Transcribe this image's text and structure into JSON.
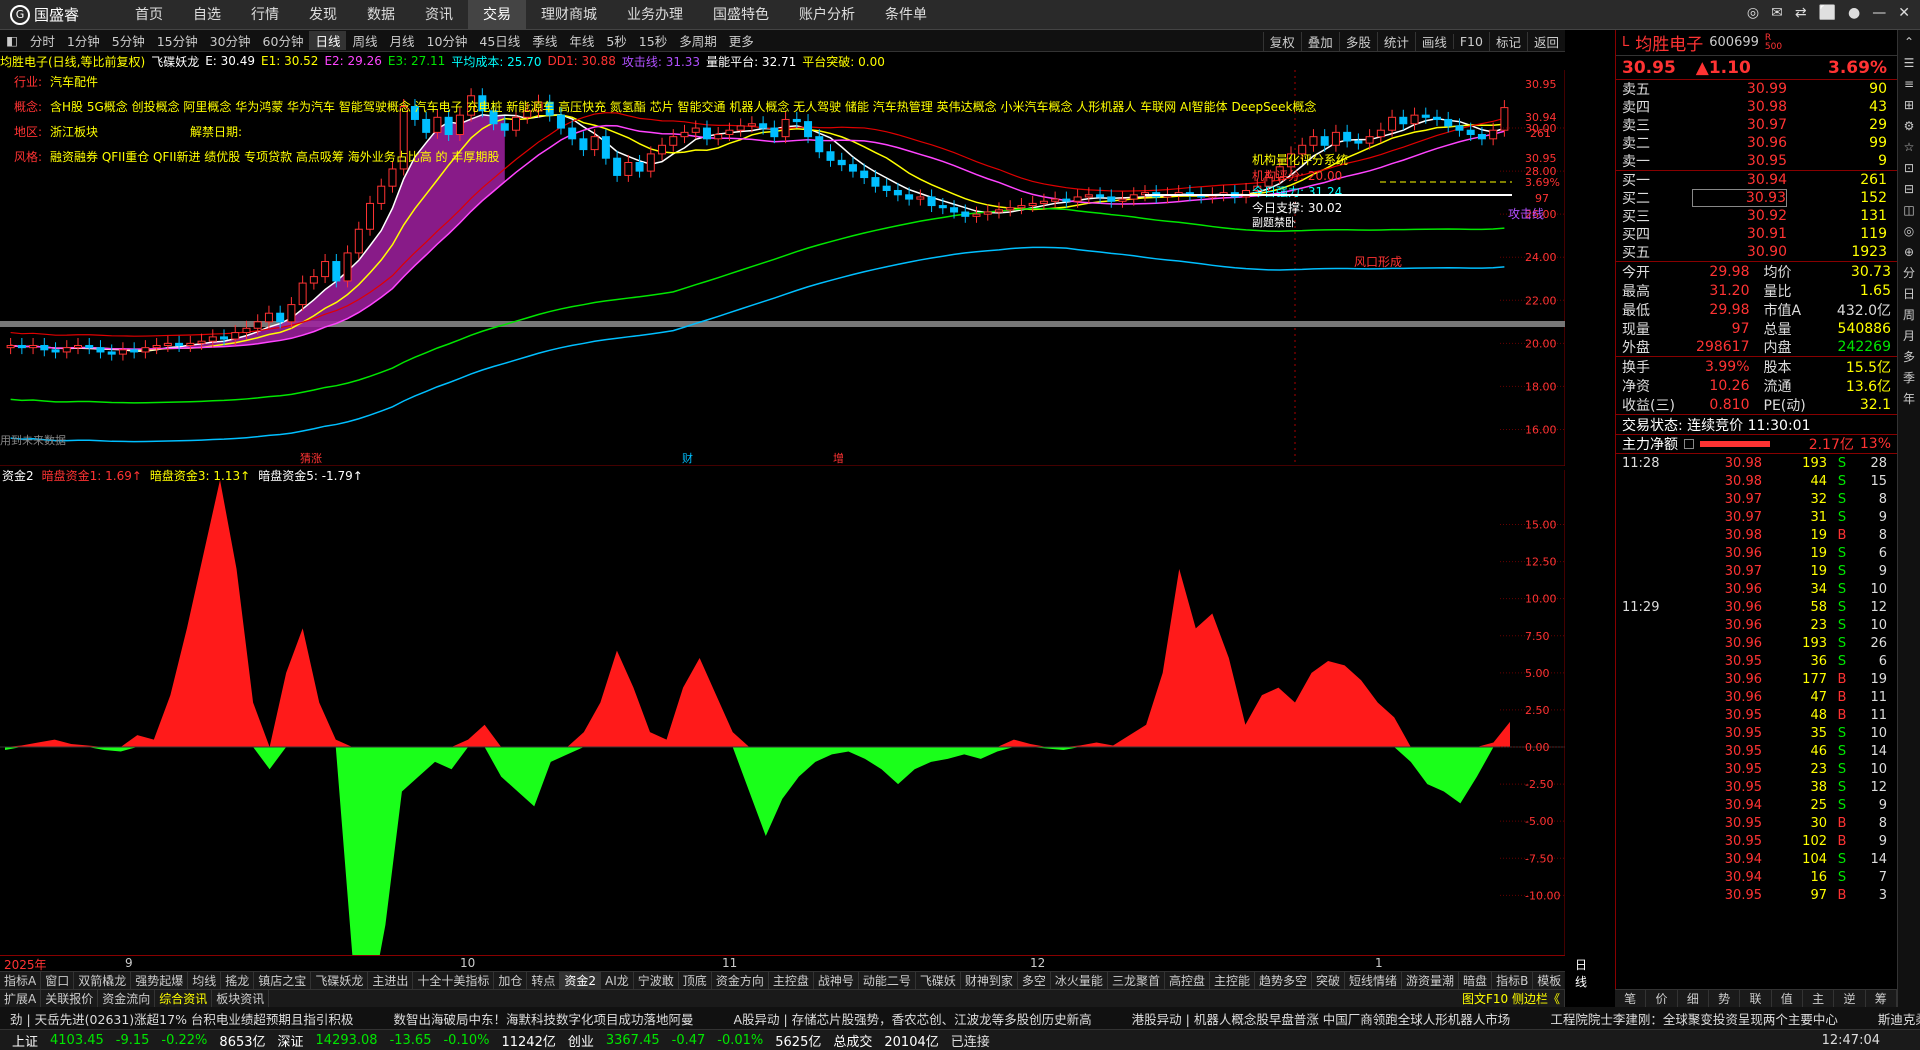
{
  "app": {
    "logo": "国盛睿"
  },
  "menu": [
    "首页",
    "自选",
    "行情",
    "发现",
    "数据",
    "资讯",
    "交易",
    "理财商城",
    "业务办理",
    "国盛特色",
    "账户分析",
    "条件单"
  ],
  "window_controls": [
    "◎",
    "✉",
    "⇄",
    "⬜",
    "●",
    "—",
    "✕"
  ],
  "periods": [
    "分时",
    "1分钟",
    "5分钟",
    "15分钟",
    "30分钟",
    "60分钟",
    "日线",
    "周线",
    "月线",
    "10分钟",
    "45日线",
    "季线",
    "年线",
    "5秒",
    "15秒",
    "多周期",
    "更多"
  ],
  "period_selected": "日线",
  "chart_tools": [
    "复权",
    "叠加",
    "多股",
    "统计",
    "画线",
    "F10",
    "标记",
    "返回"
  ],
  "kline_info": {
    "title": "均胜电子(日线,等比前复权)",
    "indicator": "飞碟妖龙",
    "e": "E: 30.49",
    "e1": "E1: 30.52",
    "e2": "E2: 29.26",
    "e3": "E3: 27.11",
    "avg_cost": "平均成本: 25.70",
    "dd1": "DD1: 30.88",
    "attack": "攻击线: 31.33",
    "platform": "量能平台: 32.71",
    "breakout": "平台突破: 0.00"
  },
  "overlay": {
    "industry_label": "行业:",
    "industry": "汽车配件",
    "concept_label": "概念:",
    "concepts": "含H股 5G概念 创投概念 阿里概念 华为鸿蒙 华为汽车 智能驾驶概念 汽车电子 充电桩 新能源车 高压快充 氮氢酯 芯片 智能交通 机器人概念 无人驾驶 储能 汽车热管理 英伟达概念 小米汽车概念 人形机器人 车联网 AI智能体 DeepSeek概念",
    "region_label": "地区:",
    "region": "浙江板块",
    "unlock_label": "解禁日期:",
    "style_label": "风格:",
    "styles": "融资融券 QFII重仓 QFII新进 绩优股 专项贷款 高点吸筹 海外业务占比高 的 丰厚期股",
    "note": "用到未来数据",
    "score_title": "机构量化评分系统",
    "score": "机构评分: 20.00",
    "force": "今日强力: 31.24",
    "support": "今日支撑: 30.02",
    "sideline": "副题禁卧",
    "attack_tag": "攻击线",
    "fengkou": "风口形成",
    "marks": [
      "猜涨",
      "财",
      "增"
    ]
  },
  "price_axis": [
    "30.95",
    "30.94",
    "261",
    "30.95",
    "3.69%",
    "97",
    "30.00",
    "28.00",
    "26.00",
    "24.00",
    "22.00",
    "20.00",
    "18.00",
    "16.00"
  ],
  "sub_info": {
    "name": "资金2",
    "f1": "暗盘资金1: 1.69↑",
    "f3": "暗盘资金3: 1.13↑",
    "f5": "暗盘资金5: -1.79↑"
  },
  "sub_axis": [
    "15.00",
    "12.50",
    "10.00",
    "7.50",
    "5.00",
    "2.50",
    "0.00",
    "-2.50",
    "-5.00",
    "-7.50",
    "-10.00"
  ],
  "x_axis": [
    "2025年",
    "9",
    "10",
    "11",
    "12",
    "1"
  ],
  "x_axis_right": "日线",
  "tabs1": [
    "指标A",
    "窗口",
    "双箭橇龙",
    "强势起爆",
    "均线",
    "搖龙",
    "镇店之宝",
    "飞碟妖龙",
    "主进出",
    "十全十美指标",
    "加仓",
    "转点",
    "资金2",
    "AI龙",
    "宁波敢",
    "顶底",
    "资金方向",
    "主控盘",
    "战神号",
    "动能二号",
    "飞碟妖",
    "财神到家",
    "多空",
    "冰火量能",
    "三龙聚首",
    "高控盘",
    "主控能",
    "趋势多空",
    "突破",
    "短线情绪",
    "游资量潮",
    "暗盘",
    "指标B",
    "模板"
  ],
  "tabs1_selected": "资金2",
  "tabs2": [
    "扩展A",
    "关联报价",
    "资金流向",
    "综合资讯",
    "板块资讯"
  ],
  "tabs2_selected": "综合资讯",
  "tabs2_right": "图文F10 侧边栏《",
  "ticker": [
    "劲 | 天岳先进(02631)涨超17% 台积电业绩超预期且指引积极",
    "数智出海破局中东！海默科技数字化项目成功落地阿曼",
    "A股异动 | 存储芯片股强势，香农芯创、江波龙等多股创历史新高",
    "港股异动 | 机器人概念股早盘普涨 中国厂商领跑全球人形机器人市场",
    "工程院院士李建刚：全球聚变投资呈现两个主要中心",
    "斯迪克柔性三维"
  ],
  "status": {
    "sh_label": "上证",
    "sh_val": "4103.45",
    "sh_chg": "-9.15",
    "sh_pct": "-0.22%",
    "sh_amt": "8653亿",
    "sz_label": "深证",
    "sz_val": "14293.08",
    "sz_chg": "-13.65",
    "sz_pct": "-0.10%",
    "sz_amt": "11242亿",
    "cy_label": "创业",
    "cy_val": "3367.45",
    "cy_chg": "-0.47",
    "cy_pct": "-0.01%",
    "cy_amt": "5625亿",
    "total_label": "总成交",
    "total": "20104亿",
    "conn": "已连接",
    "time": "12:47:04"
  },
  "right": {
    "prefix": "L",
    "name": "均胜电子",
    "code": "600699",
    "code_tag": "R 500",
    "price": "30.95",
    "change": "▲1.10",
    "pct": "3.69%",
    "asks": [
      {
        "l": "卖五",
        "p": "30.99",
        "v": "90"
      },
      {
        "l": "卖四",
        "p": "30.98",
        "v": "43"
      },
      {
        "l": "卖三",
        "p": "30.97",
        "v": "29"
      },
      {
        "l": "卖二",
        "p": "30.96",
        "v": "99"
      },
      {
        "l": "卖一",
        "p": "30.95",
        "v": "9"
      }
    ],
    "bids": [
      {
        "l": "买一",
        "p": "30.94",
        "v": "261"
      },
      {
        "l": "买二",
        "p": "30.93",
        "v": "152"
      },
      {
        "l": "买三",
        "p": "30.92",
        "v": "131"
      },
      {
        "l": "买四",
        "p": "30.91",
        "v": "119"
      },
      {
        "l": "买五",
        "p": "30.90",
        "v": "1923"
      }
    ],
    "stats": [
      [
        "今开",
        "29.98",
        "均价",
        "30.73"
      ],
      [
        "最高",
        "31.20",
        "量比",
        "1.65"
      ],
      [
        "最低",
        "29.98",
        "市值A",
        "432.0亿"
      ],
      [
        "现量",
        "97",
        "总量",
        "540886"
      ],
      [
        "外盘",
        "298617",
        "内盘",
        "242269"
      ],
      [
        "换手",
        "3.99%",
        "股本",
        "15.5亿"
      ],
      [
        "净资",
        "10.26",
        "流通",
        "13.6亿"
      ],
      [
        "收益(三)",
        "0.810",
        "PE(动)",
        "32.1"
      ]
    ],
    "trade_state": "交易状态: 连续竞价 11:30:01",
    "net_label": "主力净额",
    "net_val": "2.17亿",
    "net_pct": "13%",
    "ticks": [
      {
        "t": "11:28",
        "p": "30.98",
        "v": "193",
        "s": "S",
        "n": "28"
      },
      {
        "t": "",
        "p": "30.98",
        "v": "44",
        "s": "S",
        "n": "15"
      },
      {
        "t": "",
        "p": "30.97",
        "v": "32",
        "s": "S",
        "n": "8"
      },
      {
        "t": "",
        "p": "30.97",
        "v": "31",
        "s": "S",
        "n": "9"
      },
      {
        "t": "",
        "p": "30.98",
        "v": "19",
        "s": "B",
        "n": "8"
      },
      {
        "t": "",
        "p": "30.96",
        "v": "19",
        "s": "S",
        "n": "6"
      },
      {
        "t": "",
        "p": "30.97",
        "v": "19",
        "s": "S",
        "n": "9"
      },
      {
        "t": "",
        "p": "30.96",
        "v": "34",
        "s": "S",
        "n": "10"
      },
      {
        "t": "11:29",
        "p": "30.96",
        "v": "58",
        "s": "S",
        "n": "12"
      },
      {
        "t": "",
        "p": "30.96",
        "v": "23",
        "s": "S",
        "n": "10"
      },
      {
        "t": "",
        "p": "30.96",
        "v": "193",
        "s": "S",
        "n": "26"
      },
      {
        "t": "",
        "p": "30.95",
        "v": "36",
        "s": "S",
        "n": "6"
      },
      {
        "t": "",
        "p": "30.96",
        "v": "177",
        "s": "B",
        "n": "19"
      },
      {
        "t": "",
        "p": "30.96",
        "v": "47",
        "s": "B",
        "n": "11"
      },
      {
        "t": "",
        "p": "30.95",
        "v": "48",
        "s": "B",
        "n": "11"
      },
      {
        "t": "",
        "p": "30.95",
        "v": "35",
        "s": "S",
        "n": "10"
      },
      {
        "t": "",
        "p": "30.95",
        "v": "46",
        "s": "S",
        "n": "14"
      },
      {
        "t": "",
        "p": "30.95",
        "v": "23",
        "s": "S",
        "n": "10"
      },
      {
        "t": "",
        "p": "30.95",
        "v": "38",
        "s": "S",
        "n": "12"
      },
      {
        "t": "",
        "p": "30.94",
        "v": "25",
        "s": "S",
        "n": "9"
      },
      {
        "t": "",
        "p": "30.95",
        "v": "30",
        "s": "B",
        "n": "8"
      },
      {
        "t": "",
        "p": "30.95",
        "v": "102",
        "s": "B",
        "n": "9"
      },
      {
        "t": "",
        "p": "30.94",
        "v": "104",
        "s": "S",
        "n": "14"
      },
      {
        "t": "",
        "p": "30.94",
        "v": "16",
        "s": "S",
        "n": "7"
      },
      {
        "t": "",
        "p": "30.95",
        "v": "97",
        "s": "B",
        "n": "3"
      }
    ],
    "bottom_tabs": [
      "笔",
      "价",
      "细",
      "势",
      "联",
      "值",
      "主",
      "逆",
      "筹"
    ]
  },
  "vtabs": [
    "⌃",
    "☰",
    "≡",
    "⊞",
    "⚙",
    "☆",
    "⊡",
    "⊟",
    "◫",
    "◎",
    "⊕",
    "分",
    "日",
    "周",
    "月",
    "多",
    "季",
    "年"
  ],
  "chart_data": [
    {
      "type": "candlestick",
      "title": "均胜电子(日线,等比前复权)",
      "y_ticks": [
        16.0,
        18.0,
        20.0,
        22.0,
        24.0,
        26.0,
        28.0,
        30.0
      ],
      "ylim": [
        15,
        32
      ],
      "x_labels": [
        "2025年",
        "9",
        "10",
        "11",
        "12",
        "1"
      ],
      "close": [
        19.9,
        19.8,
        19.9,
        19.7,
        19.6,
        19.8,
        19.9,
        19.8,
        19.6,
        19.5,
        19.7,
        19.6,
        19.8,
        19.9,
        20.0,
        19.9,
        20.0,
        20.1,
        20.3,
        20.2,
        20.5,
        20.7,
        21.0,
        21.4,
        21.0,
        21.8,
        22.8,
        23.1,
        23.8,
        22.9,
        24.2,
        25.3,
        26.5,
        27.3,
        28.1,
        31.0,
        30.4,
        29.8,
        30.5,
        29.7,
        30.6,
        31.5,
        30.8,
        30.2,
        29.9,
        30.5,
        30.8,
        31.2,
        30.6,
        30.0,
        29.5,
        29.0,
        29.6,
        28.6,
        27.8,
        28.4,
        28.0,
        28.8,
        29.2,
        29.6,
        29.8,
        30.0,
        29.5,
        29.7,
        29.9,
        30.1,
        30.2,
        30.0,
        29.6,
        30.4,
        30.3,
        29.6,
        28.9,
        28.5,
        28.3,
        28.0,
        27.7,
        27.3,
        27.1,
        26.9,
        26.7,
        26.8,
        26.4,
        26.3,
        26.1,
        25.9,
        26.0,
        26.1,
        26.2,
        26.3,
        26.4,
        26.5,
        26.6,
        26.7,
        26.6,
        26.8,
        26.9,
        26.8,
        26.6,
        26.7,
        26.9,
        27.0,
        26.8,
        26.9,
        27.0,
        26.9,
        26.8,
        26.9,
        27.0,
        26.8,
        27.1,
        27.3,
        27.7,
        28.2,
        28.8,
        29.2,
        29.6,
        29.2,
        29.8,
        29.4,
        29.3,
        29.6,
        29.9,
        30.5,
        30.2,
        30.6,
        30.5,
        30.4,
        30.1,
        29.9,
        29.7,
        29.5,
        29.9,
        30.95
      ],
      "ma_lines": [
        "E",
        "E1",
        "E2",
        "E3",
        "平均成本",
        "攻击线"
      ]
    },
    {
      "type": "area",
      "title": "资金2",
      "y_ticks": [
        -10.0,
        -7.5,
        -5.0,
        -2.5,
        0.0,
        2.5,
        5.0,
        7.5,
        10.0,
        12.5,
        15.0
      ],
      "ylim": [
        -12,
        18
      ],
      "values": [
        -0.2,
        0.1,
        0.3,
        0.5,
        0.2,
        0.1,
        -0.2,
        -0.3,
        0.8,
        0.5,
        3.5,
        8.0,
        13.0,
        18.0,
        12.0,
        3.0,
        -1.5,
        5.0,
        8.0,
        3.0,
        0.5,
        -14.0,
        -18.0,
        -12.0,
        -3.0,
        -2.0,
        -1.0,
        -1.5,
        0.5,
        1.5,
        -2.0,
        -3.0,
        -4.0,
        -1.0,
        -0.5,
        1.0,
        3.0,
        6.5,
        4.0,
        1.0,
        0.5,
        4.0,
        6.0,
        3.5,
        1.0,
        -3.0,
        -6.0,
        -3.5,
        -2.0,
        -1.0,
        -0.5,
        -0.3,
        -0.8,
        -1.5,
        -2.5,
        -1.5,
        -1.0,
        -0.8,
        -0.5,
        -0.8,
        -0.3,
        0.5,
        0.2,
        -0.1,
        -0.2,
        0.1,
        0.3,
        0.1,
        0.8,
        1.5,
        5.0,
        12.0,
        8.0,
        9.0,
        6.0,
        1.5,
        3.5,
        4.0,
        3.0,
        5.0,
        5.8,
        5.5,
        4.5,
        3.0,
        2.0,
        -1.0,
        -2.5,
        -3.0,
        -3.8,
        -2.0,
        0.3,
        1.69
      ]
    }
  ]
}
